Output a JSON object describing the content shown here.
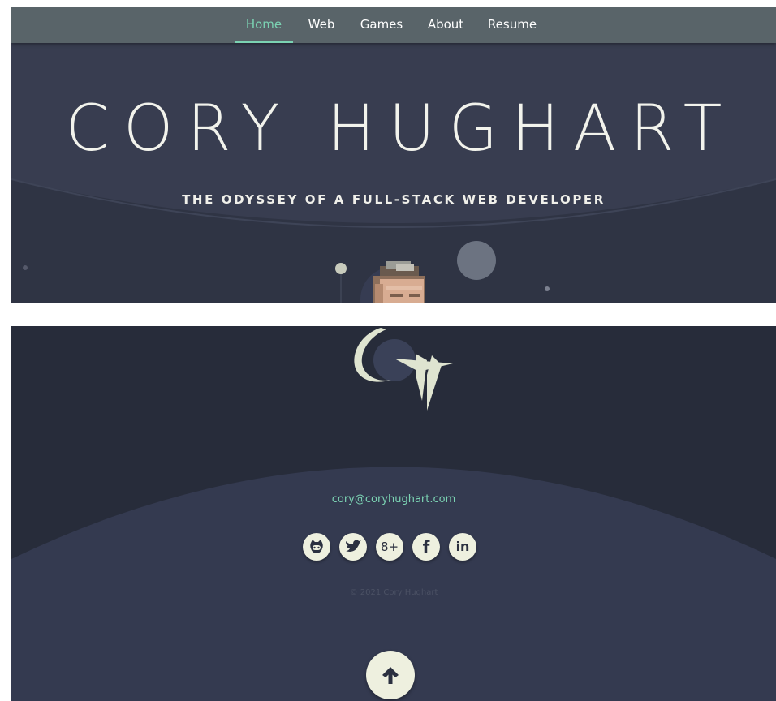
{
  "colors": {
    "accent": "#7bd3b3",
    "nav_bg": "#596469",
    "hero_bg": "#383d50",
    "footer_bg": "#272c3a",
    "cream": "#eef0df"
  },
  "nav": {
    "items": [
      {
        "label": "Home",
        "active": true
      },
      {
        "label": "Web",
        "active": false
      },
      {
        "label": "Games",
        "active": false
      },
      {
        "label": "About",
        "active": false
      },
      {
        "label": "Resume",
        "active": false
      }
    ]
  },
  "hero": {
    "title": "CORY HUGHART",
    "subtitle": "THE ODYSSEY OF A FULL-STACK WEB DEVELOPER"
  },
  "footer": {
    "logo_icon": "ch-monogram-logo",
    "email": "cory@coryhughart.com",
    "social": [
      {
        "icon": "github-icon",
        "glyph": ""
      },
      {
        "icon": "twitter-icon",
        "glyph": ""
      },
      {
        "icon": "google-plus-icon",
        "glyph": "8+"
      },
      {
        "icon": "facebook-icon",
        "glyph": "f"
      },
      {
        "icon": "linkedin-icon",
        "glyph": "in"
      }
    ],
    "copyright": "© 2021 Cory Hughart",
    "back_to_top_icon": "arrow-up-icon"
  }
}
